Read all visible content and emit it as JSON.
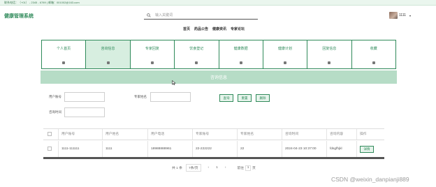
{
  "topbar": {
    "contact": "联系电话：（+01） - 2345 - 6789 | 邮箱：001002@163.com"
  },
  "header": {
    "logo": "健康管理系统",
    "search_placeholder": "输入关键词",
    "username": "1111",
    "caret": "▾"
  },
  "nav": [
    "首页",
    "药品公告",
    "健康资讯",
    "专家论坛"
  ],
  "categories": [
    {
      "label": "个人首页",
      "active": false
    },
    {
      "label": "咨询信息",
      "active": true
    },
    {
      "label": "专家回复",
      "active": false
    },
    {
      "label": "饮食登记",
      "active": false
    },
    {
      "label": "健康数据",
      "active": false
    },
    {
      "label": "健康计划",
      "active": false
    },
    {
      "label": "回复信息",
      "active": false
    },
    {
      "label": "收藏",
      "active": false
    }
  ],
  "banner": {
    "title": "咨询信息"
  },
  "filters": {
    "user_account": "用户账号",
    "expert_name": "专家姓名",
    "consult_time": "咨询时间"
  },
  "buttons": {
    "query": "查询",
    "reset": "重置",
    "delete": "删除"
  },
  "table": {
    "headers": [
      "用户账号",
      "用户姓名",
      "用户电话",
      "专家账号",
      "专家姓名",
      "咨询时间",
      "咨询内容",
      "操作"
    ],
    "rows": [
      {
        "user_account": "1111-111111",
        "user_name": "1111",
        "user_phone": "18988888961",
        "expert_account": "22-222222",
        "expert_name": "22",
        "consult_time": "2024-04-23 10:37:00",
        "content": "fdsgfhjkl",
        "action": "详情"
      }
    ]
  },
  "pager": {
    "total": "共 1 条",
    "page_size": "7条/页",
    "prev": "‹",
    "page": "1",
    "next": "›",
    "goto": "前往",
    "goto_value": "1",
    "page_unit": "页"
  },
  "watermark": "CSDN @weixin_danpianji889",
  "colors": {
    "accent": "#2f8a5a",
    "banner": "#b6dcc6",
    "active_tab": "#d7eee0",
    "topbar": "#eaf6ee"
  }
}
